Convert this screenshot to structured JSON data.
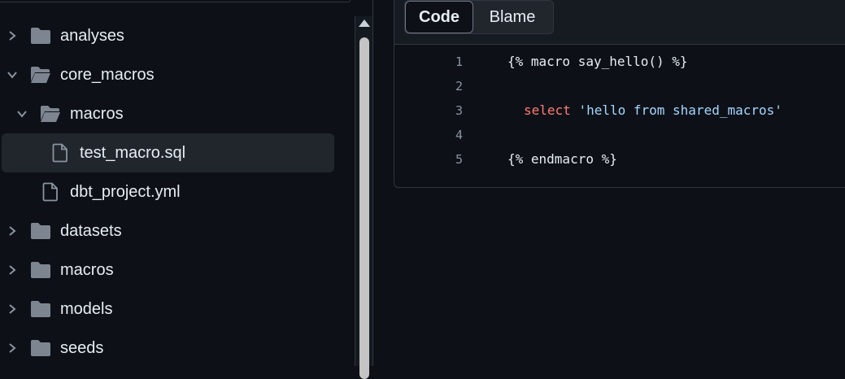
{
  "file_tree": {
    "items": [
      {
        "label": "analyses",
        "type": "folder",
        "state": "collapsed",
        "depth": 0
      },
      {
        "label": "core_macros",
        "type": "folder",
        "state": "expanded",
        "depth": 0
      },
      {
        "label": "macros",
        "type": "folder",
        "state": "expanded",
        "depth": 1
      },
      {
        "label": "test_macro.sql",
        "type": "file",
        "depth": 2,
        "selected": true
      },
      {
        "label": "dbt_project.yml",
        "type": "file",
        "depth": 1
      },
      {
        "label": "datasets",
        "type": "folder",
        "state": "collapsed",
        "depth": 0
      },
      {
        "label": "macros",
        "type": "folder",
        "state": "collapsed",
        "depth": 0
      },
      {
        "label": "models",
        "type": "folder",
        "state": "collapsed",
        "depth": 0
      },
      {
        "label": "seeds",
        "type": "folder",
        "state": "collapsed",
        "depth": 0
      }
    ]
  },
  "viewer": {
    "tabs": [
      {
        "label": "Code",
        "active": true
      },
      {
        "label": "Blame",
        "active": false
      }
    ],
    "lines": [
      {
        "number": "1",
        "text": "{% macro say_hello() %}"
      },
      {
        "number": "2",
        "text": ""
      },
      {
        "number": "3",
        "keyword": "select",
        "string": "'hello from shared_macros'"
      },
      {
        "number": "4",
        "text": ""
      },
      {
        "number": "5",
        "text": "{% endmacro %}"
      }
    ]
  },
  "icons": {
    "folder": "folder-icon",
    "open_folder": "folder-open-icon",
    "file": "file-icon",
    "chevron_right": "chevron-right-icon",
    "chevron_down": "chevron-down-icon"
  },
  "colors": {
    "background": "#0d1117",
    "text": "#e6edf3",
    "folder_icon": "#7d8590",
    "keyword": "#ff7b72",
    "string": "#a5d6ff",
    "line_number": "#8b949e",
    "selected_row": "#21262d"
  }
}
